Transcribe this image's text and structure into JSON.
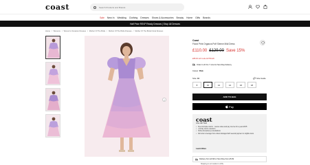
{
  "header": {
    "logo": "coast",
    "search_placeholder": "Search Products and Brands",
    "icons": [
      "user-icon",
      "heart-icon",
      "bag-icon"
    ]
  },
  "nav": {
    "items": [
      "Sale",
      "New In",
      "Wedding",
      "Clothing",
      "Dresses",
      "Shoes & Accessories",
      "Beauty",
      "Home",
      "Gifts",
      "Brands"
    ]
  },
  "promo": {
    "text": "Half Price RSVP Ready Dresses | Shop All Dresses"
  },
  "breadcrumb": {
    "items": [
      "Home",
      "/",
      "Womens",
      "/",
      "Women's Occasion Dresses",
      "/",
      "Mother Of The Bride",
      "/",
      "Mother Of The Bride Dresses",
      "/",
      "Mother Of The Bride Floral Dresses"
    ]
  },
  "product": {
    "brand": "Coast",
    "name": "Floral Print Organza Puff Sleeve Midi Dress",
    "price_now": "£110.00",
    "price_was": "£129.00",
    "save": "Save 15%",
    "extra_offer": "£88.00 with code EXTRA20",
    "delivery_text": "Order in 22 hrs 7 mins for Next Day Delivery",
    "colour_label": "Colour:",
    "colour_value": "Pink",
    "size_label": "Size:",
    "size_value": "10",
    "size_guide": "Size Guide",
    "sizes": [
      "8",
      "10",
      "12",
      "14",
      "16",
      "18"
    ],
    "selected_size": "10",
    "add_to_bag": "ADD TO BAG",
    "apple_pay": "Pay"
  },
  "loyalty": {
    "brand": "coast",
    "subtitle": "UNLIMITED",
    "benefits": [
      "Free & simple returns · receive value and pay one fee for a year £9.95",
      "+14 day return extension",
      "Online list-delivery consultations",
      "Full order coverage from orders damaged with several payment or eligible items"
    ],
    "learn_more": "Learn More"
  },
  "delivery_box": {
    "text": "Delivery from £3.99 or Next Day from £5.99",
    "more": "Shipping in our location to 200+"
  },
  "colors": {
    "accent_red": "#d6322e",
    "black": "#111111",
    "loyalty_bg": "#f1f1f1"
  }
}
